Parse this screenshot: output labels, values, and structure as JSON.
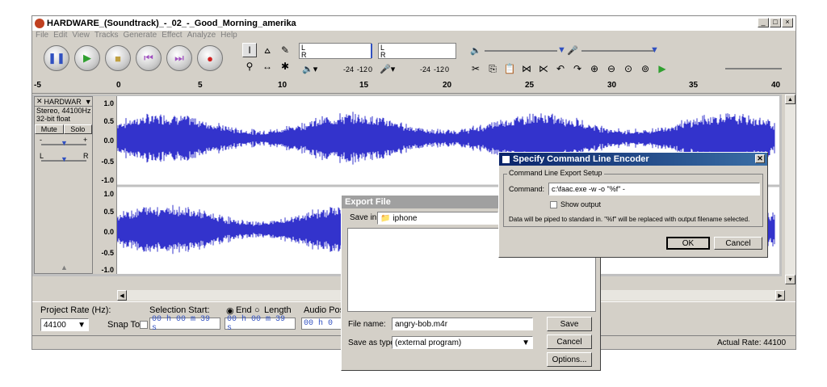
{
  "window": {
    "title": "HARDWARE_(Soundtrack)_-_02_-_Good_Morning_amerika",
    "buttons": [
      "_",
      "□",
      "×"
    ]
  },
  "menu": [
    "File",
    "Edit",
    "View",
    "Tracks",
    "Generate",
    "Effect",
    "Analyze",
    "Help"
  ],
  "meters": {
    "left": "L",
    "right": "R",
    "db1": "-24",
    "db2": "-12",
    "db3": "0"
  },
  "ruler": {
    "ticks": [
      "-5",
      "0",
      "5",
      "10",
      "15",
      "20",
      "25",
      "30",
      "35",
      "40"
    ]
  },
  "track": {
    "name": "HARDWAR",
    "info1": "Stereo, 44100Hz",
    "info2": "32-bit float",
    "mute": "Mute",
    "solo": "Solo",
    "gain_minus": "-",
    "gain_plus": "+",
    "pan_l": "L",
    "pan_r": "R",
    "labels_top": [
      "1.0",
      "0.5",
      "0.0",
      "-0.5",
      "-1.0"
    ],
    "labels_bottom": [
      "1.0",
      "0.5",
      "0.0",
      "-0.5",
      "-1.0"
    ],
    "wave_color": "#3333cc"
  },
  "bottom": {
    "project_rate_label": "Project Rate (Hz):",
    "project_rate": "44100",
    "snap_to": "Snap To",
    "selection_start": "Selection Start:",
    "end": "End",
    "length": "Length",
    "audio_pos": "Audio Posi",
    "time1": "00 h 00 m 39 s",
    "time2": "00 h 00 m 39 s",
    "time3": "00 h 0",
    "actual_rate": "Actual Rate: 44100"
  },
  "export": {
    "title": "Export File",
    "save_in_label": "Save in:",
    "save_in": "iphone",
    "file_name_label": "File name:",
    "file_name": "angry-bob.m4r",
    "save_type_label": "Save as type:",
    "save_type": "(external program)",
    "save": "Save",
    "cancel": "Cancel",
    "options": "Options..."
  },
  "encoder": {
    "title": "Specify Command Line Encoder",
    "group": "Command Line Export Setup",
    "command_label": "Command:",
    "command": "c:\\faac.exe -w -o \"%f\" -",
    "show_output": "Show output",
    "info": "Data will be piped to standard in. \"%f\" will be replaced with output filename selected.",
    "ok": "OK",
    "cancel": "Cancel"
  }
}
